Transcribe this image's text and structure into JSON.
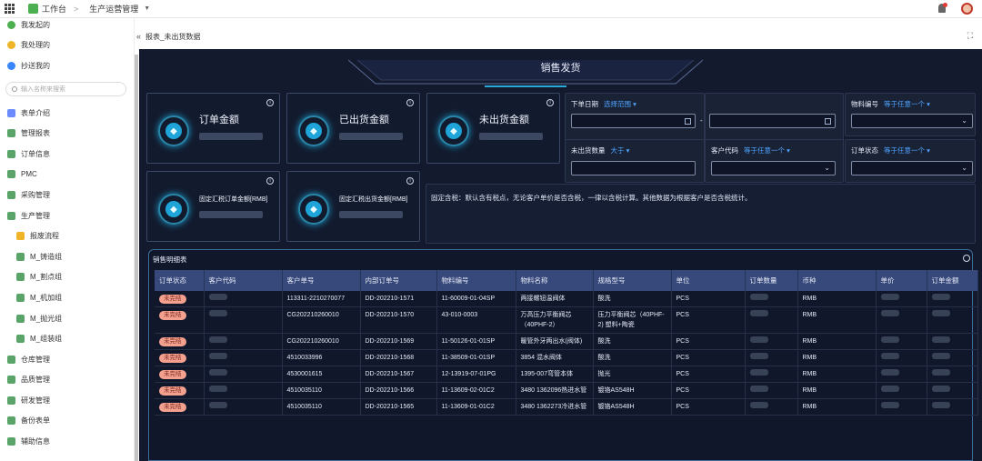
{
  "topbar": {
    "workspace": "工作台",
    "module": "生产运营管理"
  },
  "sidebar": {
    "items_top": [
      {
        "label": "我发起的",
        "color": "#4caf50"
      },
      {
        "label": "我处理的",
        "color": "#f0b429"
      },
      {
        "label": "抄送我的",
        "color": "#3a86ff"
      }
    ],
    "search_placeholder": "输入名称来搜索",
    "items": [
      {
        "label": "表单介绍",
        "sub": false,
        "color": "#6b8afd"
      },
      {
        "label": "管理报表",
        "sub": false,
        "color": "#5aa469"
      },
      {
        "label": "订单信息",
        "sub": false,
        "color": "#5aa469"
      },
      {
        "label": "PMC",
        "sub": false,
        "color": "#5aa469"
      },
      {
        "label": "采购管理",
        "sub": false,
        "color": "#5aa469"
      },
      {
        "label": "生产管理",
        "sub": false,
        "color": "#5aa469"
      },
      {
        "label": "报废流程",
        "sub": true,
        "color": "#f0b429"
      },
      {
        "label": "M_铸造组",
        "sub": true,
        "color": "#5aa469"
      },
      {
        "label": "M_割点组",
        "sub": true,
        "color": "#5aa469"
      },
      {
        "label": "M_机加组",
        "sub": true,
        "color": "#5aa469"
      },
      {
        "label": "M_抛光组",
        "sub": true,
        "color": "#5aa469"
      },
      {
        "label": "M_组装组",
        "sub": true,
        "color": "#5aa469"
      },
      {
        "label": "仓库管理",
        "sub": false,
        "color": "#5aa469"
      },
      {
        "label": "品质管理",
        "sub": false,
        "color": "#5aa469"
      },
      {
        "label": "研发管理",
        "sub": false,
        "color": "#5aa469"
      },
      {
        "label": "备份表单",
        "sub": false,
        "color": "#5aa469"
      },
      {
        "label": "辅助信息",
        "sub": false,
        "color": "#5aa469"
      }
    ]
  },
  "page": {
    "breadcrumb": "报表_未出货数据",
    "dashboard_title": "销售发货"
  },
  "kpis": [
    {
      "label": "订单金额"
    },
    {
      "label": "已出货金额"
    },
    {
      "label": "未出货金额"
    },
    {
      "label": "固定汇税订单金额[RMB]"
    },
    {
      "label": "固定汇税出货金额[RMB]"
    }
  ],
  "filters": {
    "order_date": {
      "label": "下单日期",
      "mode": "选择范围"
    },
    "material_no": {
      "label": "物料编号",
      "mode": "等于任意一个"
    },
    "unshipped_qty": {
      "label": "未出货数量",
      "mode": "大于"
    },
    "customer_code": {
      "label": "客户代码",
      "mode": "等于任意一个"
    },
    "order_status": {
      "label": "订单状态",
      "mode": "等于任意一个"
    },
    "range_sep": "-"
  },
  "note": "固定含税：默认含有税点，无论客户单价是否含税，一律以含税计算。其他数据为根据客户是否含税统计。",
  "table": {
    "title": "销售明细表",
    "columns": [
      "订单状态",
      "客户代码",
      "客户单号",
      "内部订单号",
      "物料编号",
      "物料名称",
      "规格型号",
      "单位",
      "订单数量",
      "币种",
      "单价",
      "订单金额"
    ],
    "rows": [
      [
        "未完结",
        "",
        "113311-2210270077",
        "DD-202210-1571",
        "11-60009-01-04SP",
        "两接螺钮温阀体",
        "酸洗",
        "PCS",
        "",
        "RMB",
        "",
        ""
      ],
      [
        "未完结",
        "",
        "CG202210260010",
        "DD-202210-1570",
        "43-010-0003",
        "万高压力平衡阀芯（40PHF-2）",
        "压力平衡阀芯（40PHF-2) 塑料+陶瓷",
        "PCS",
        "",
        "RMB",
        "",
        ""
      ],
      [
        "未完结",
        "",
        "CG202210260010",
        "DD-202210-1569",
        "11-50126-01-01SP",
        "暖管外牙两出水(阀体)",
        "酸洗",
        "PCS",
        "",
        "RMB",
        "",
        ""
      ],
      [
        "未完结",
        "",
        "4510033996",
        "DD-202210-1568",
        "11-38509-01-01SP",
        "3854 混水阀体",
        "酸洗",
        "PCS",
        "",
        "RMB",
        "",
        ""
      ],
      [
        "未完结",
        "",
        "4530001615",
        "DD-202210-1567",
        "12-13919-07-01PG",
        "1395-007弯管本体",
        "抛光",
        "PCS",
        "",
        "RMB",
        "",
        ""
      ],
      [
        "未完结",
        "",
        "4510035110",
        "DD-202210-1566",
        "11-13609-02-01C2",
        "3480 1362096热进水管",
        "镀铬AS548H",
        "PCS",
        "",
        "RMB",
        "",
        ""
      ],
      [
        "未完结",
        "",
        "4510035110",
        "DD-202210-1565",
        "11-13609-01-01C2",
        "3480 1362273冷进水管",
        "镀铬AS548H",
        "PCS",
        "",
        "RMB",
        "",
        ""
      ]
    ]
  }
}
